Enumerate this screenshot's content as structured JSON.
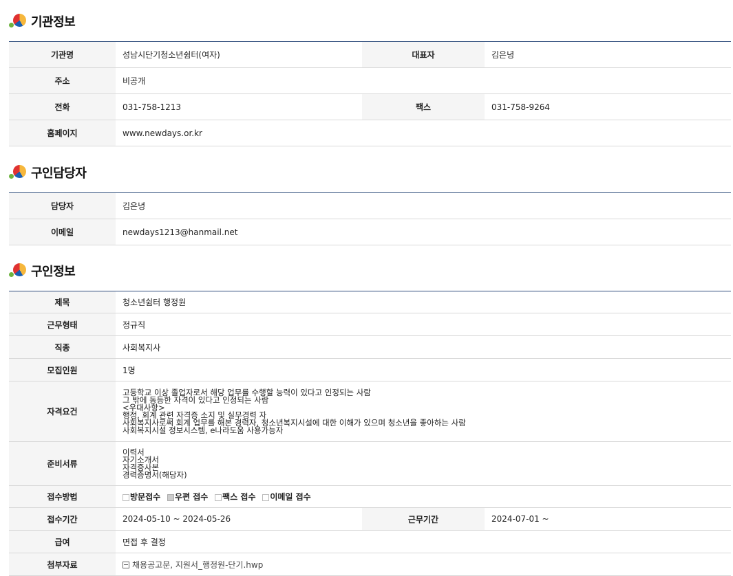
{
  "org_section": {
    "title": "기관정보",
    "org_name_label": "기관명",
    "org_name": "성남시단기청소년쉼터(여자)",
    "rep_label": "대표자",
    "rep": "김은녕",
    "address_label": "주소",
    "address": "비공개",
    "phone_label": "전화",
    "phone": "031-758-1213",
    "fax_label": "팩스",
    "fax": "031-758-9264",
    "homepage_label": "홈페이지",
    "homepage": "www.newdays.or.kr"
  },
  "contact_section": {
    "title": "구인담당자",
    "manager_label": "담당자",
    "manager": "김은녕",
    "email_label": "이메일",
    "email": "newdays1213@hanmail.net"
  },
  "job_section": {
    "title": "구인정보",
    "subject_label": "제목",
    "subject": "청소년쉼터 행정원",
    "work_type_label": "근무형태",
    "work_type": "정규직",
    "job_type_label": "직종",
    "job_type": "사회복지사",
    "headcount_label": "모집인원",
    "headcount": "1명",
    "qualification_label": "자격요건",
    "qualification_lines": [
      "고등학교 이상 졸업자로서 해당 업무를 수행할 능력이 있다고 인정되는 사람",
      "그 밖에 동등한 자격이 있다고 인정되는 사람",
      "<우대사항>",
      "행정, 회계 관련 자격증 소지 및 실무경력 자",
      "사회복지사로써 회계 업무를 해본 경력자, 청소년복지시설에 대한 이해가 있으며 청소년을 좋아하는 사람",
      "사회복지시설 정보시스템, e나라도움 사용가능자"
    ],
    "documents_label": "준비서류",
    "documents_lines": [
      "이력서",
      "자기소개서",
      "자격증사본",
      "경력증명서(해당자)"
    ],
    "receipt_label": "접수방법",
    "receipt_methods": [
      {
        "label": "방문접수",
        "checked": false
      },
      {
        "label": "우편 접수",
        "checked": true
      },
      {
        "label": "팩스 접수",
        "checked": false
      },
      {
        "label": "이메일 접수",
        "checked": false
      }
    ],
    "period_label": "접수기간",
    "period": "2024-05-10 ~ 2024-05-26",
    "work_period_label": "근무기간",
    "work_period": "2024-07-01 ~",
    "salary_label": "급여",
    "salary": "면접 후 결정",
    "attachment_label": "첨부자료",
    "attachment": "채용공고문, 지원서_행정원-단기.hwp"
  }
}
